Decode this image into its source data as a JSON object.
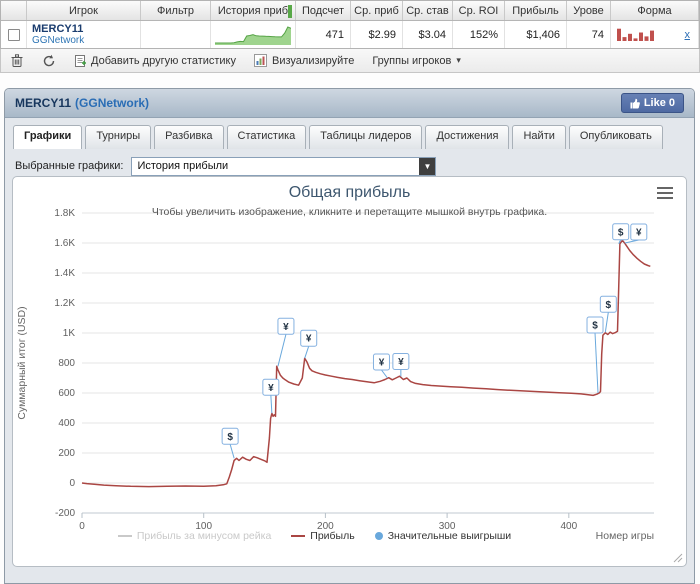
{
  "table": {
    "headers": [
      "",
      "Игрок",
      "Фильтр",
      "История приб",
      "Подсчет",
      "Ср. приб",
      "Ср. став",
      "Ср. ROI",
      "Прибыль",
      "Урове",
      "Форма"
    ],
    "row": {
      "player": "MERCY11",
      "network": "GGNetwork",
      "filter": "",
      "count": "471",
      "avg_profit": "$2.99",
      "avg_stake": "$3.04",
      "avg_roi": "152%",
      "profit": "$1,406",
      "level": "74",
      "remove_link": "x"
    },
    "sparkline": {
      "values": [
        0,
        0,
        0,
        0,
        0,
        0,
        0.02,
        0.07,
        0.1,
        0.09,
        0.44,
        0.47,
        0.52,
        0.45,
        0.44,
        0.43,
        0.42,
        0.41,
        0.4,
        0.39,
        0.38,
        0.38,
        0.62,
        1.0,
        0.92
      ],
      "fill": "#9fd48e",
      "stroke": "#55a345"
    },
    "form_bars": {
      "values": [
        0.95,
        0.3,
        0.55,
        0.2,
        0.65,
        0.35,
        0.8
      ],
      "color": "#c0504d"
    }
  },
  "toolbar": {
    "add_stat": "Добавить другую статистику",
    "visualize": "Визуализируйте",
    "groups": "Группы игроков",
    "caret": "▾"
  },
  "panel": {
    "player": "MERCY11",
    "network": "(GGNetwork)",
    "like": "Like 0",
    "tabs": [
      "Графики",
      "Турниры",
      "Разбивка",
      "Статистика",
      "Таблицы лидеров",
      "Достижения",
      "Найти",
      "Опубликовать"
    ],
    "active_tab": "Графики",
    "selected_label": "Выбранные графики:",
    "chart_select": "История прибыли",
    "select_arrow": "▼"
  },
  "chart_data": {
    "type": "line",
    "title": "Общая прибыль",
    "subtitle": "Чтобы увеличить изображение, кликните и перетащите мышкой внутрь графика.",
    "xlabel": "Номер игры",
    "ylabel": "Суммарный итог (USD)",
    "xlim": [
      0,
      470
    ],
    "ylim": [
      -200,
      1800
    ],
    "grid": true,
    "legend_position": "bottom",
    "xticks": [
      {
        "v": 0,
        "label": "0"
      },
      {
        "v": 100,
        "label": "100"
      },
      {
        "v": 200,
        "label": "200"
      },
      {
        "v": 300,
        "label": "300"
      },
      {
        "v": 400,
        "label": "400"
      }
    ],
    "yticks": [
      {
        "v": -200,
        "label": "-200"
      },
      {
        "v": 0,
        "label": "0"
      },
      {
        "v": 200,
        "label": "200"
      },
      {
        "v": 400,
        "label": "400"
      },
      {
        "v": 600,
        "label": "600"
      },
      {
        "v": 800,
        "label": "800"
      },
      {
        "v": 1000,
        "label": "1K"
      },
      {
        "v": 1200,
        "label": "1.2K"
      },
      {
        "v": 1400,
        "label": "1.4K"
      },
      {
        "v": 1600,
        "label": "1.6K"
      },
      {
        "v": 1800,
        "label": "1.8K"
      }
    ],
    "legend": [
      {
        "label": "Прибыль за минусом рейка",
        "color": "#c9c9c9",
        "text_color": "#c9c9c9",
        "swatch": "line"
      },
      {
        "label": "Прибыль",
        "color": "#aa4643",
        "text_color": "#333333",
        "swatch": "line"
      },
      {
        "label": "Значительные выигрыши",
        "color": "#69a8dc",
        "text_color": "#333333",
        "swatch": "dot"
      }
    ],
    "series": [
      {
        "name": "Прибыль за минусом рейка",
        "color": "#c9c9c9",
        "visible": false,
        "points": []
      },
      {
        "name": "Прибыль",
        "color": "#aa4643",
        "visible": true,
        "points": [
          [
            0,
            0
          ],
          [
            4,
            -4
          ],
          [
            10,
            -8
          ],
          [
            18,
            -14
          ],
          [
            28,
            -18
          ],
          [
            40,
            -22
          ],
          [
            55,
            -24
          ],
          [
            70,
            -22
          ],
          [
            85,
            -20
          ],
          [
            100,
            -22
          ],
          [
            110,
            -18
          ],
          [
            116,
            -12
          ],
          [
            119,
            -5
          ],
          [
            121,
            40
          ],
          [
            123,
            90
          ],
          [
            125,
            150
          ],
          [
            127,
            165
          ],
          [
            129,
            150
          ],
          [
            132,
            172
          ],
          [
            135,
            158
          ],
          [
            138,
            150
          ],
          [
            141,
            176
          ],
          [
            144,
            168
          ],
          [
            147,
            158
          ],
          [
            150,
            148
          ],
          [
            152,
            138
          ],
          [
            154,
            300
          ],
          [
            155,
            430
          ],
          [
            156,
            465
          ],
          [
            157,
            445
          ],
          [
            158,
            455
          ],
          [
            159,
            445
          ],
          [
            160,
            778
          ],
          [
            161,
            755
          ],
          [
            163,
            718
          ],
          [
            165,
            700
          ],
          [
            167,
            688
          ],
          [
            170,
            672
          ],
          [
            174,
            660
          ],
          [
            178,
            652
          ],
          [
            181,
            700
          ],
          [
            183,
            832
          ],
          [
            185,
            805
          ],
          [
            187,
            765
          ],
          [
            189,
            748
          ],
          [
            192,
            738
          ],
          [
            196,
            728
          ],
          [
            200,
            720
          ],
          [
            205,
            712
          ],
          [
            210,
            704
          ],
          [
            216,
            696
          ],
          [
            222,
            690
          ],
          [
            228,
            682
          ],
          [
            234,
            675
          ],
          [
            240,
            668
          ],
          [
            245,
            678
          ],
          [
            249,
            690
          ],
          [
            252,
            702
          ],
          [
            255,
            688
          ],
          [
            258,
            700
          ],
          [
            261,
            712
          ],
          [
            264,
            690
          ],
          [
            267,
            700
          ],
          [
            270,
            676
          ],
          [
            274,
            664
          ],
          [
            280,
            656
          ],
          [
            287,
            650
          ],
          [
            295,
            646
          ],
          [
            303,
            642
          ],
          [
            312,
            638
          ],
          [
            322,
            633
          ],
          [
            332,
            628
          ],
          [
            342,
            623
          ],
          [
            352,
            618
          ],
          [
            362,
            614
          ],
          [
            372,
            610
          ],
          [
            382,
            606
          ],
          [
            392,
            602
          ],
          [
            402,
            598
          ],
          [
            410,
            594
          ],
          [
            416,
            588
          ],
          [
            420,
            584
          ],
          [
            423,
            592
          ],
          [
            425,
            600
          ],
          [
            426,
            610
          ],
          [
            427,
            860
          ],
          [
            428,
            985
          ],
          [
            430,
            1002
          ],
          [
            432,
            990
          ],
          [
            434,
            1006
          ],
          [
            436,
            996
          ],
          [
            438,
            1002
          ],
          [
            440,
            1012
          ],
          [
            441,
            1300
          ],
          [
            442,
            1595
          ],
          [
            444,
            1618
          ],
          [
            446,
            1598
          ],
          [
            448,
            1575
          ],
          [
            450,
            1550
          ],
          [
            453,
            1522
          ],
          [
            456,
            1498
          ],
          [
            459,
            1478
          ],
          [
            462,
            1460
          ],
          [
            465,
            1450
          ],
          [
            467,
            1445
          ]
        ]
      }
    ],
    "significant_wins": {
      "name": "Значительные выигрыши",
      "color": "#69a8dc",
      "box_border": "#85b1e0",
      "markers": [
        {
          "x": 125,
          "y": 165,
          "symbol": "$",
          "ox": -4,
          "oy": -22
        },
        {
          "x": 156,
          "y": 465,
          "symbol": "¥",
          "ox": -1,
          "oy": -26
        },
        {
          "x": 161,
          "y": 778,
          "symbol": "¥",
          "ox": 8,
          "oy": -40
        },
        {
          "x": 183,
          "y": 832,
          "symbol": "¥",
          "ox": 4,
          "oy": -20
        },
        {
          "x": 251,
          "y": 700,
          "symbol": "¥",
          "ox": -6,
          "oy": -16
        },
        {
          "x": 262,
          "y": 710,
          "symbol": "¥",
          "ox": 0,
          "oy": -15
        },
        {
          "x": 424,
          "y": 600,
          "symbol": "$",
          "ox": -3,
          "oy": -68
        },
        {
          "x": 430,
          "y": 1005,
          "symbol": "$",
          "ox": 3,
          "oy": -28
        },
        {
          "x": 441,
          "y": 1595,
          "symbol": "$",
          "ox": 2,
          "oy": -12
        },
        {
          "x": 446,
          "y": 1600,
          "symbol": "¥",
          "ox": 14,
          "oy": -11
        }
      ]
    }
  }
}
